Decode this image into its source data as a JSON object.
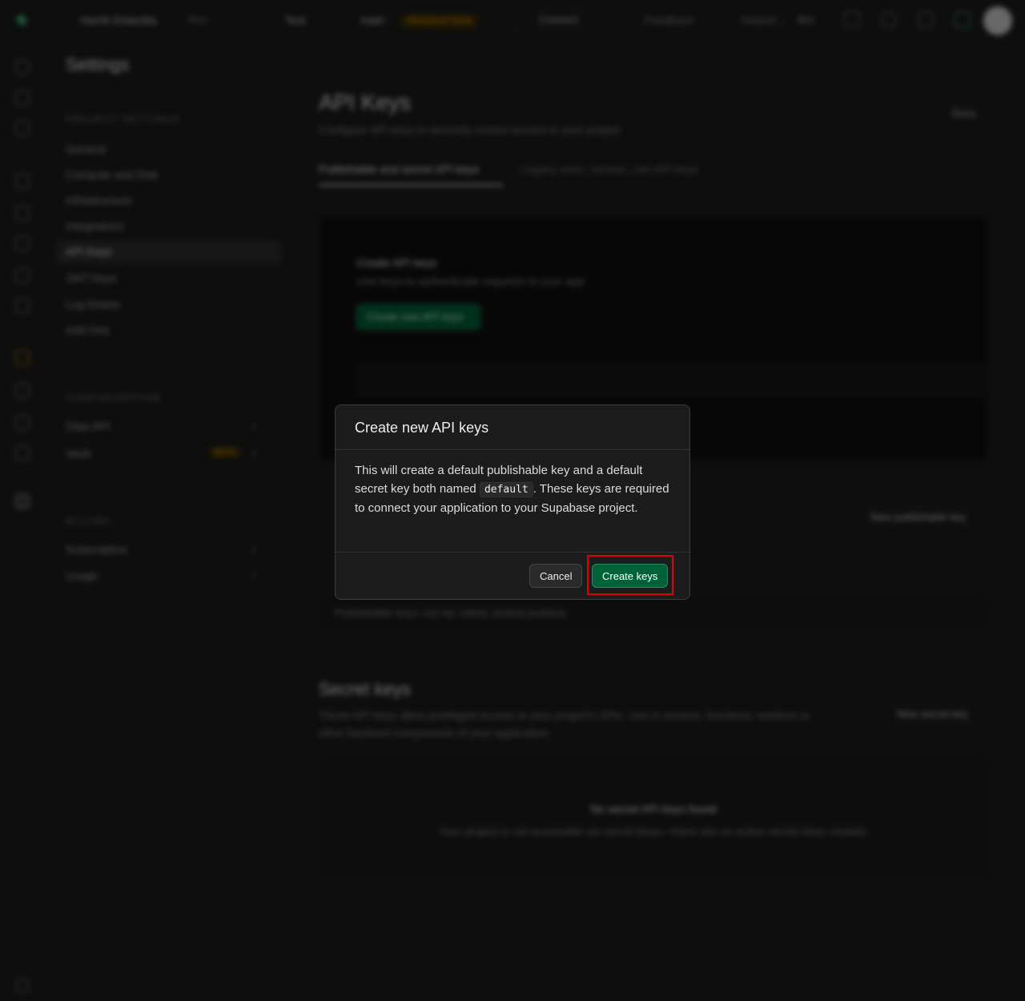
{
  "topbar": {
    "org": "Harrik Enlandia",
    "org_plan": "Pro",
    "project": "Test",
    "branch": "main",
    "branch_badge": "PRODUCTION",
    "connect": "Connect",
    "feedback": "Feedback",
    "search": "Search...",
    "shortcut": "⌘K"
  },
  "sidebar": {
    "title": "Settings",
    "project_section": "PROJECT SETTINGS",
    "project_items": [
      "General",
      "Compute and Disk",
      "Infrastructure",
      "Integrations",
      "API Keys",
      "JWT Keys",
      "Log Drains",
      "Add Ons"
    ],
    "config_section": "CONFIGURATION",
    "config_items": [
      "Data API",
      "Vault"
    ],
    "vault_badge": "BETA",
    "billing_section": "BILLING",
    "billing_items": [
      "Subscription",
      "Usage"
    ]
  },
  "main": {
    "title": "API Keys",
    "subtitle": "Configure API keys to securely control access to your project",
    "docs": "Docs",
    "tabs": [
      "Publishable and secret API keys",
      "Legacy anon, service_role API keys"
    ],
    "create_panel": {
      "title": "Create API keys",
      "subtitle": "Use keys to authenticate requests to your app",
      "button": "Create new API keys"
    },
    "publishable_btn": "New publishable key",
    "publishable_note": "Publishable keys can be safely shared publicly",
    "secret": {
      "title": "Secret keys",
      "subtitle": "These API keys allow privileged access to your project's APIs. Use in servers, functions, workers or other backend components of your application.",
      "button": "New secret key",
      "empty_title": "No secret API keys found",
      "empty_sub": "Your project is not accessible via secret keys—there are no active secret keys created."
    }
  },
  "modal": {
    "title": "Create new API keys",
    "body_pre": "This will create a default publishable key and a default secret key both named",
    "body_code": "default",
    "body_post": ". These keys are required to connect your application to your Supabase project.",
    "cancel": "Cancel",
    "create": "Create keys"
  },
  "colors": {
    "background": "#1c1c1c",
    "brand_green": "#006239",
    "warning": "#f1a10d",
    "highlight": "#e0000c"
  }
}
